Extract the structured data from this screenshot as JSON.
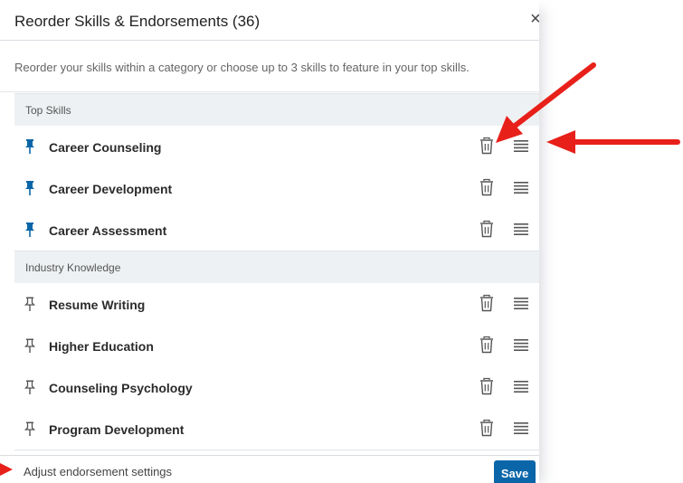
{
  "dialog": {
    "title": "Reorder Skills & Endorsements (36)",
    "close_glyph": "×",
    "instructions": "Reorder your skills within a category or choose up to 3 skills to feature in your top skills."
  },
  "sections": [
    {
      "title": "Top Skills",
      "skills": [
        {
          "name": "Career Counseling",
          "pinned": true
        },
        {
          "name": "Career Development",
          "pinned": true
        },
        {
          "name": "Career Assessment",
          "pinned": true
        }
      ]
    },
    {
      "title": "Industry Knowledge",
      "skills": [
        {
          "name": "Resume Writing",
          "pinned": false
        },
        {
          "name": "Higher Education",
          "pinned": false
        },
        {
          "name": "Counseling Psychology",
          "pinned": false
        },
        {
          "name": "Program Development",
          "pinned": false
        }
      ]
    }
  ],
  "footer": {
    "adjust_label": "Adjust endorsement settings",
    "save_label": "Save"
  },
  "colors": {
    "pinned": "#0a66a8",
    "unpinned": "#555555",
    "save_bg": "#0a66a8",
    "annotation_arrow": "#e8201a"
  },
  "icons": {
    "pin": "pin-icon",
    "trash": "trash-icon",
    "drag": "drag-handle-icon",
    "close": "close-icon"
  }
}
